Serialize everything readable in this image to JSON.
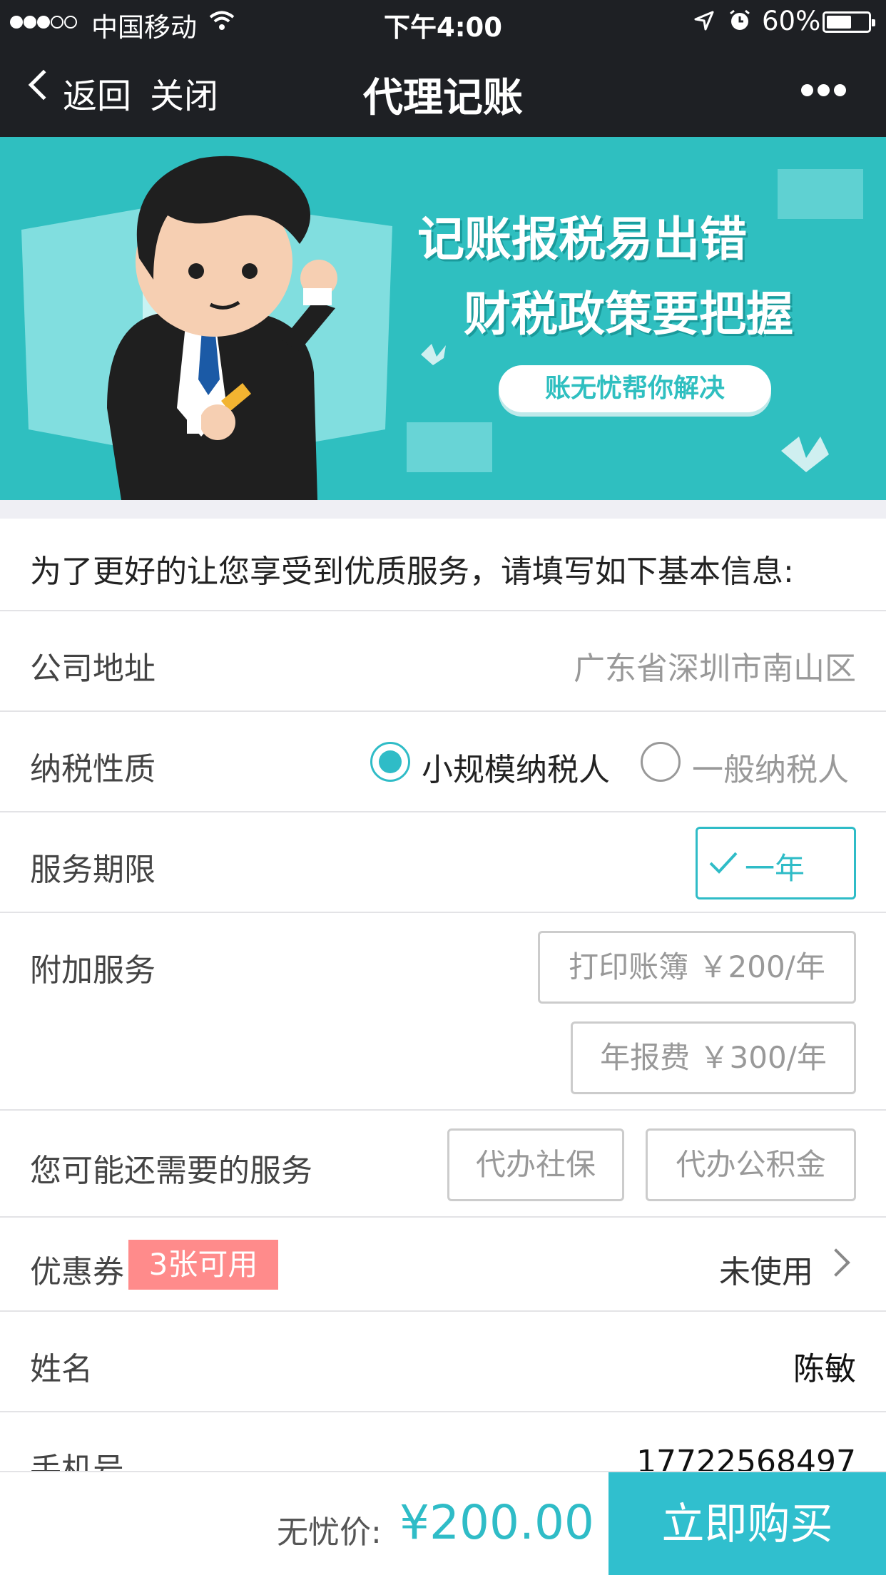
{
  "status_bar": {
    "carrier": "中国移动",
    "time": "下午4:00",
    "battery": "60%",
    "battery_level": 0.6,
    "signal_bars_filled": 3,
    "signal_bars_total": 5
  },
  "nav": {
    "back_label": "返回",
    "close_label": "关闭",
    "title": "代理记账"
  },
  "banner": {
    "line1": "记账报税易出错",
    "line2": "财税政策要把握",
    "pill": "账无忧帮你解决"
  },
  "intro": "为了更好的让您享受到优质服务，请填写如下基本信息:",
  "form": {
    "address": {
      "label": "公司地址",
      "value": "广东省深圳市南山区"
    },
    "tax_type": {
      "label": "纳税性质",
      "options": [
        "小规模纳税人",
        "一般纳税人"
      ],
      "selected": "小规模纳税人"
    },
    "period": {
      "label": "服务期限",
      "option": "一年"
    },
    "extra": {
      "label": "附加服务",
      "options": [
        "打印账簿 ￥200/年",
        "年报费 ￥300/年"
      ]
    },
    "maybe": {
      "label": "您可能还需要的服务",
      "options": [
        "代办社保",
        "代办公积金"
      ]
    },
    "coupon": {
      "label": "优惠券",
      "tag": "3张可用",
      "status": "未使用"
    },
    "name": {
      "label": "姓名",
      "value": "陈敏"
    },
    "phone": {
      "label": "手机号",
      "value": "17722568497"
    }
  },
  "footer": {
    "price_label": "无忧价:",
    "price": "¥200.00",
    "buy_label": "立即购买"
  },
  "colors": {
    "accent": "#2fbcc7",
    "banner_bg": "#2fbfc0",
    "coupon_tag": "#ff8b8b",
    "nav_bg": "#1e2024"
  },
  "icons": [
    "signal-dots-icon",
    "wifi-icon",
    "location-arrow-icon",
    "alarm-icon",
    "battery-icon",
    "chevron-left-icon",
    "more-icon",
    "check-icon",
    "chevron-right-icon"
  ]
}
